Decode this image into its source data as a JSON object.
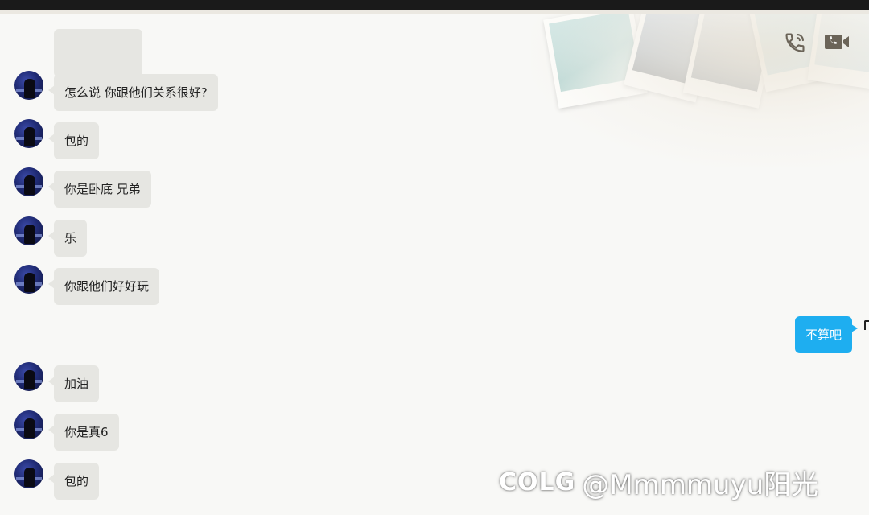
{
  "header": {
    "icons": [
      "phone-call-icon",
      "video-call-icon"
    ]
  },
  "messages": [
    {
      "side": "left",
      "text": "怎么说 你跟他们关系很好?"
    },
    {
      "side": "left",
      "text": "包的"
    },
    {
      "side": "left",
      "text": "你是卧底 兄弟"
    },
    {
      "side": "left",
      "text": "乐"
    },
    {
      "side": "left",
      "text": "你跟他们好好玩"
    },
    {
      "side": "right",
      "text": "不算吧"
    },
    {
      "side": "left",
      "text": "加油"
    },
    {
      "side": "left",
      "text": "你是真6"
    },
    {
      "side": "left",
      "text": "包的"
    }
  ],
  "watermark": {
    "logo": "COLG",
    "handle": "@Mmmmuyu阳光"
  },
  "colors": {
    "incoming_bubble": "#e6e6e2",
    "outgoing_bubble": "#1eaef0",
    "background": "#f8f8f6",
    "icon": "#6b6458"
  }
}
